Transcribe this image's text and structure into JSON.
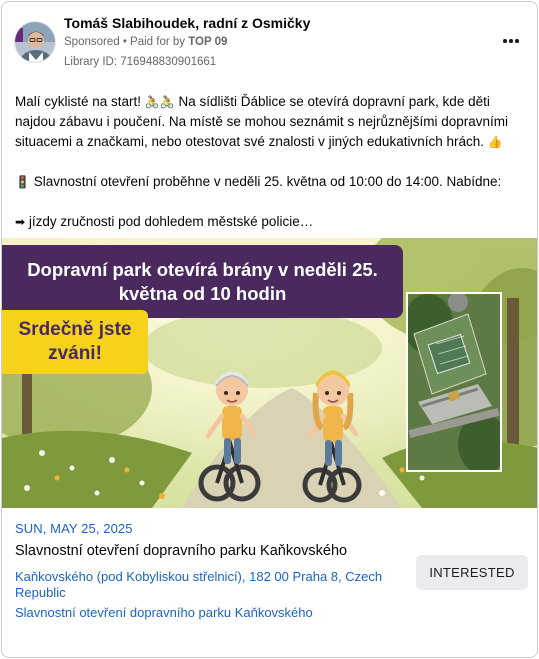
{
  "post": {
    "page_name": "Tomáš Slabihoudek, radní z Osmičky",
    "sponsored_label": "Sponsored",
    "paid_for_prefix": " • Paid for by ",
    "paid_for_by": "TOP 09",
    "library_id": "Library ID: 716948830901661",
    "more_icon": "more-horizontal-icon",
    "text": {
      "p1_a": "Malí cyklisté na start! ",
      "p1_emoji": "🚴🚴",
      "p1_b": " Na sídlišti Ďáblice se otevírá dopravní park, kde děti najdou zábavu i poučení. Na místě se mohou seznámit s nejrůznějšími dopravními situacemi a značkami, nebo otestovat své znalosti v jiných edukativních hrách. ",
      "p1_end_emoji": "👍",
      "p2_emoji": "🚦",
      "p2": " Slavnostní otevření proběhne v neděli 25. května od 10:00 do 14:00. Nabídne:",
      "p3_emoji": "➡",
      "p3": " jízdy zručnosti pod dohledem městské policie…"
    }
  },
  "creative": {
    "headline": "Dopravní park otevírá brány v neděli 25. května od 10 hodin",
    "invite": "Srdečně jste zváni!",
    "colors": {
      "headline_bg": "#4a2a5e",
      "invite_bg": "#f6d21c"
    }
  },
  "event": {
    "date": "SUN, MAY 25, 2025",
    "title": "Slavnostní otevření dopravního parku Kaňkovského",
    "address": "Kaňkovského (pod Kobyliskou střelnicí), 182 00 Praha 8, Czech Republic",
    "link_text": "Slavnostní otevření dopravního parku Kaňkovského",
    "interested_label": "INTERESTED"
  },
  "colors": {
    "link": "#1a64c4",
    "muted": "#65676b",
    "button_bg": "#e9ebee"
  }
}
